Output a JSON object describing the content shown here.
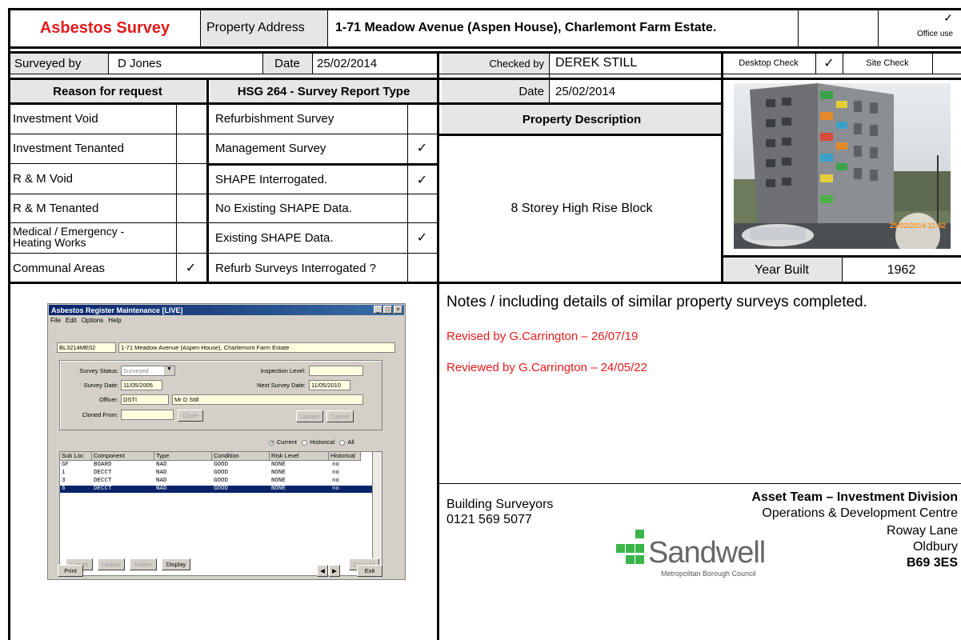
{
  "header": {
    "title": "Asbestos Survey",
    "property_address_label": "Property Address",
    "property_address": "1-71 Meadow Avenue (Aspen House), Charlemont Farm Estate.",
    "office_use_tick": "✓",
    "office_use_label": "Office use"
  },
  "survey_info": {
    "surveyed_by_label": "Surveyed by",
    "surveyed_by": "D Jones",
    "date_label": "Date",
    "date": "25/02/2014",
    "checked_by_label": "Checked by",
    "checked_by": "DEREK STILL",
    "desktop_check_label": "Desktop Check",
    "desktop_check_tick": "✓",
    "site_check_label": "Site Check",
    "checked_date_label": "Date",
    "checked_date": "25/02/2014"
  },
  "reason": {
    "heading": "Reason for request",
    "rows": [
      {
        "label": "Investment Void",
        "tick": ""
      },
      {
        "label": "Investment Tenanted",
        "tick": ""
      },
      {
        "label": "R & M Void",
        "tick": ""
      },
      {
        "label": "R & M Tenanted",
        "tick": ""
      },
      {
        "label": "Medical / Emergency -",
        "label2": "Heating Works",
        "tick": ""
      },
      {
        "label": "Communal Areas",
        "tick": "✓"
      }
    ]
  },
  "report_type": {
    "heading": "HSG 264 - Survey Report Type",
    "rows": [
      {
        "label": "Refurbishment Survey",
        "tick": ""
      },
      {
        "label": "Management Survey",
        "tick": "✓"
      },
      {
        "label": "SHAPE Interrogated.",
        "tick": "✓"
      },
      {
        "label": "No Existing SHAPE Data.",
        "tick": ""
      },
      {
        "label": "Existing SHAPE Data.",
        "tick": "✓"
      },
      {
        "label": "Refurb Surveys Interrogated ?",
        "tick": ""
      }
    ]
  },
  "property": {
    "description_heading": "Property Description",
    "description": "8 Storey High Rise Block",
    "photo_timestamp": "25/02/2014 11:52",
    "year_built_label": "Year Built",
    "year_built": "1962"
  },
  "notes": {
    "heading_bold": "Notes",
    "heading_rest": " / including details of similar property surveys completed.",
    "lines": [
      "Revised by G.Carrington – 26/07/19",
      "Reviewed by G.Carrington – 24/05/22"
    ],
    "line_color": "#e31b1b"
  },
  "footer": {
    "dept": "Building Surveyors",
    "phone": "0121 569 5077",
    "team": "Asset Team – Investment Division",
    "address": [
      "Operations & Development Centre",
      "Roway Lane",
      "Oldbury",
      "B69 3ES"
    ],
    "logo_word": "Sandwell",
    "logo_sub": "Metropolitan Borough Council",
    "logo_color": "#3bb54a"
  },
  "register_window": {
    "title": "Asbestos Register Maintenance [LIVE]",
    "menu": [
      "File",
      "Edit",
      "Options",
      "Help"
    ],
    "ref": "BL3214ME02",
    "address": "1-71 Meadow Avenue (Aspen House), Charlemont Farm Estate",
    "survey_status_label": "Survey Status:",
    "survey_status": "Surveyed",
    "inspection_level_label": "Inspection Level:",
    "inspection_level": "",
    "survey_date_label": "Survey Date:",
    "survey_date": "11/05/2005",
    "next_survey_date_label": "Next Survey Date:",
    "next_survey_date": "11/05/2010",
    "officer_label": "Officer:",
    "officer_code": "DSTI",
    "officer_name": "Mr D Still",
    "cloned_from_label": "Cloned From:",
    "cloned_from": "",
    "btn_clone": "Clone",
    "btn_update": "Update",
    "btn_cancel": "Cancel",
    "radio_current": "Current",
    "radio_historical": "Historical",
    "radio_all": "All",
    "columns": [
      "Sub Loc",
      "Component",
      "Type",
      "Condition",
      "Risk Level",
      "Historical"
    ],
    "rows": [
      [
        "GF",
        "BOARD",
        "NAD",
        "GOOD",
        "NONE",
        "no"
      ],
      [
        "1",
        "DECCT",
        "NAD",
        "GOOD",
        "NONE",
        "no"
      ],
      [
        "3",
        "DECCT",
        "NAD",
        "GOOD",
        "NONE",
        "no"
      ],
      [
        "6",
        "DECCT",
        "NAD",
        "GOOD",
        "NONE",
        "no"
      ]
    ],
    "btn_create": "Create",
    "btn_update2": "Update",
    "btn_delete": "Delete",
    "btn_display": "Display",
    "btn_copy_all": "Copy All",
    "btn_print": "Print",
    "btn_exit": "Exit"
  }
}
